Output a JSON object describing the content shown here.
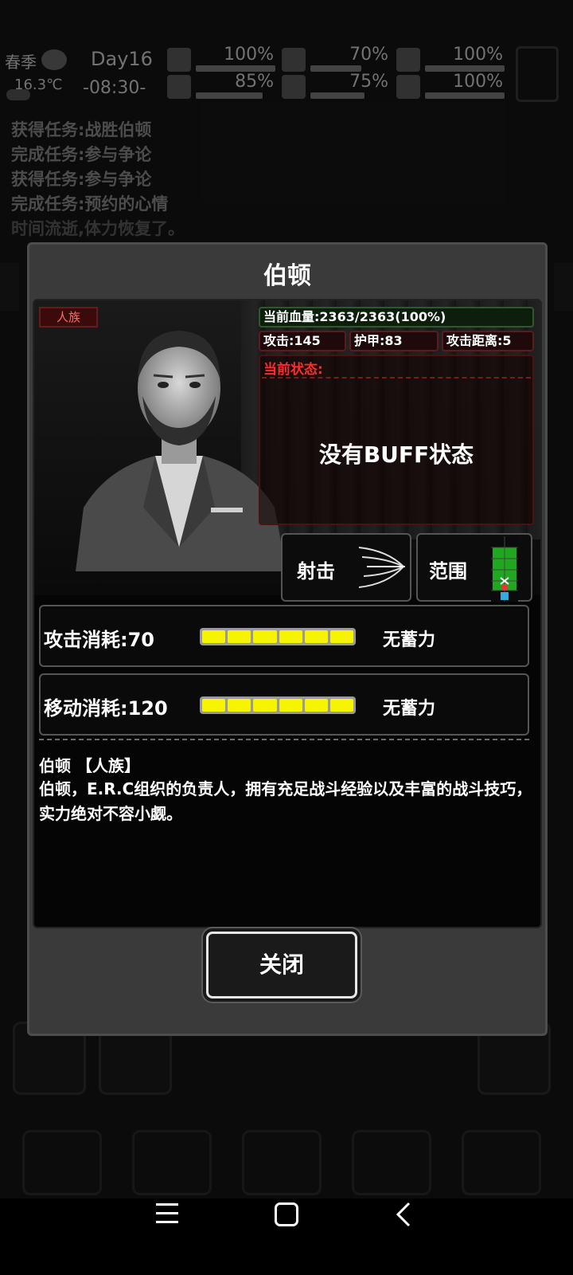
{
  "hud": {
    "season": "春季",
    "temperature": "16.3℃",
    "day": "Day16",
    "time": "-08:30-",
    "stats_top": [
      "100%",
      "70%",
      "100%"
    ],
    "stats_bottom": [
      "85%",
      "75%",
      "100%"
    ]
  },
  "log": [
    "获得任务:战胜伯顿",
    "完成任务:参与争论",
    "获得任务:参与争论",
    "完成任务:预约的心情",
    "时间流逝,体力恢复了。"
  ],
  "dialog": {
    "title": "伯顿",
    "race_tag": "人族",
    "hp": "当前血量:2363/2363(100%)",
    "attack": "攻击:145",
    "armor": "护甲:83",
    "range": "攻击距离:5",
    "state_label": "当前状态:",
    "state_text": "没有BUFF状态",
    "skill_shoot": "射击",
    "skill_range": "范围",
    "attack_cost": "攻击消耗:70",
    "move_cost": "移动消耗:120",
    "charge_label_1": "无蓄力",
    "charge_label_2": "无蓄力",
    "attack_cost_fill": 1.0,
    "move_cost_fill": 1.0,
    "desc_name": "伯顿 【人族】",
    "description": "伯顿，E.R.C组织的负责人，拥有充足战斗经验以及丰富的战斗技巧，实力绝对不容小觑。",
    "close": "关闭"
  },
  "colors": {
    "hp_border": "#2d5a2d",
    "state_label": "#ff2a2a",
    "gauge_fill": "#f7f400",
    "race_tag": "#ff6b6b"
  },
  "icons": {
    "shoot": "arrows-icon",
    "range": "grid-range-icon"
  }
}
